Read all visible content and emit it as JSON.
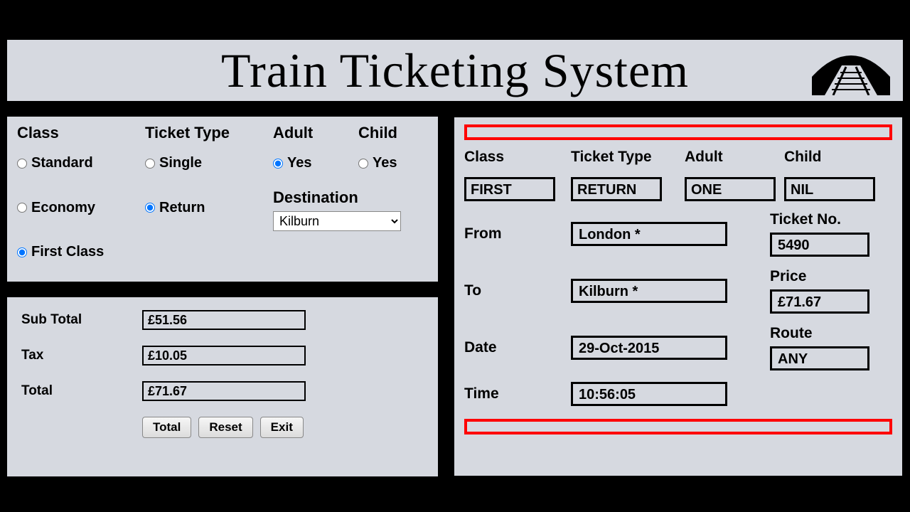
{
  "header": {
    "title": "Train Ticketing System"
  },
  "options": {
    "class_label": "Class",
    "ticket_type_label": "Ticket Type",
    "adult_label": "Adult",
    "child_label": "Child",
    "classes": [
      "Standard",
      "Economy",
      "First Class"
    ],
    "class_selected": "First Class",
    "ticket_types": [
      "Single",
      "Return"
    ],
    "ticket_type_selected": "Return",
    "adult_yes": "Yes",
    "adult_selected": true,
    "child_yes": "Yes",
    "child_selected": false,
    "destination_label": "Destination",
    "destination_value": "Kilburn"
  },
  "totals": {
    "subtotal_label": "Sub Total",
    "subtotal_value": "£51.56",
    "tax_label": "Tax",
    "tax_value": "£10.05",
    "total_label": "Total",
    "total_value": "£71.67",
    "buttons": {
      "total": "Total",
      "reset": "Reset",
      "exit": "Exit"
    }
  },
  "ticket": {
    "headers": {
      "class": "Class",
      "ticket_type": "Ticket Type",
      "adult": "Adult",
      "child": "Child"
    },
    "values": {
      "class": "FIRST",
      "ticket_type": "RETURN",
      "adult": "ONE",
      "child": "NIL"
    },
    "from_label": "From",
    "from_value": "London *",
    "to_label": "To",
    "to_value": "Kilburn *",
    "date_label": "Date",
    "date_value": "29-Oct-2015",
    "time_label": "Time",
    "time_value": "10:56:05",
    "ticket_no_label": "Ticket No.",
    "ticket_no_value": "5490",
    "price_label": "Price",
    "price_value": "£71.67",
    "route_label": "Route",
    "route_value": "ANY"
  }
}
